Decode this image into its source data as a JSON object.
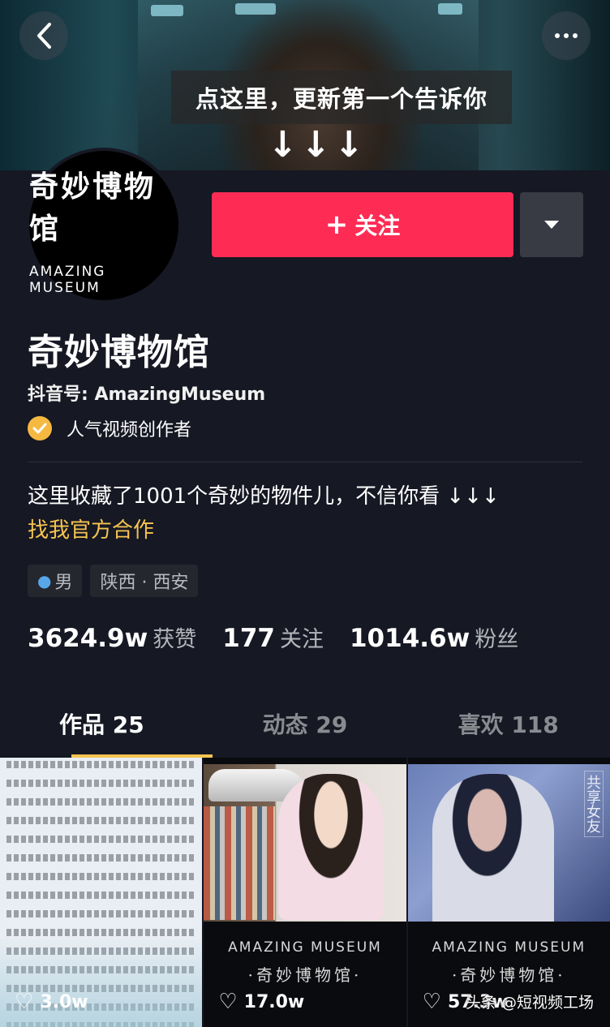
{
  "banner": {
    "caption": "点这里，更新第一个告诉你",
    "arrows": "↓↓↓"
  },
  "avatar": {
    "logo_cn": "奇妙博物馆",
    "logo_en": "AMAZING MUSEUM"
  },
  "actions": {
    "follow_label": "关注",
    "follow_plus": "+"
  },
  "profile": {
    "name": "奇妙博物馆",
    "douyin_id": "抖音号: AmazingMuseum",
    "verified_label": "人气视频创作者",
    "bio": "这里收藏了1001个奇妙的物件儿，不信你看 ↓↓↓",
    "bio_link": "找我官方合作",
    "tags": {
      "gender": "男",
      "location": "陕西 · 西安"
    }
  },
  "stats": {
    "likes_num": "3624.9w",
    "likes_label": "获赞",
    "following_num": "177",
    "following_label": "关注",
    "followers_num": "1014.6w",
    "followers_label": "粉丝"
  },
  "tabs": {
    "works": "作品 25",
    "activity": "动态 29",
    "liked": "喜欢 118"
  },
  "videos": {
    "v1_likes": "3.0w",
    "v2_likes": "17.0w",
    "v2_brand_en": "AMAZING MUSEUM",
    "v2_brand_cn": "·奇妙博物馆·",
    "v3_likes": "57.3w",
    "v3_side": "共享女友",
    "v3_brand_en": "AMAZING MUSEUM",
    "v3_brand_cn": "·奇妙博物馆·"
  },
  "watermark": "头条 @短视频工场",
  "colors": {
    "follow": "#fe2c55",
    "accent_yellow": "#f5c451",
    "background": "#161823"
  }
}
